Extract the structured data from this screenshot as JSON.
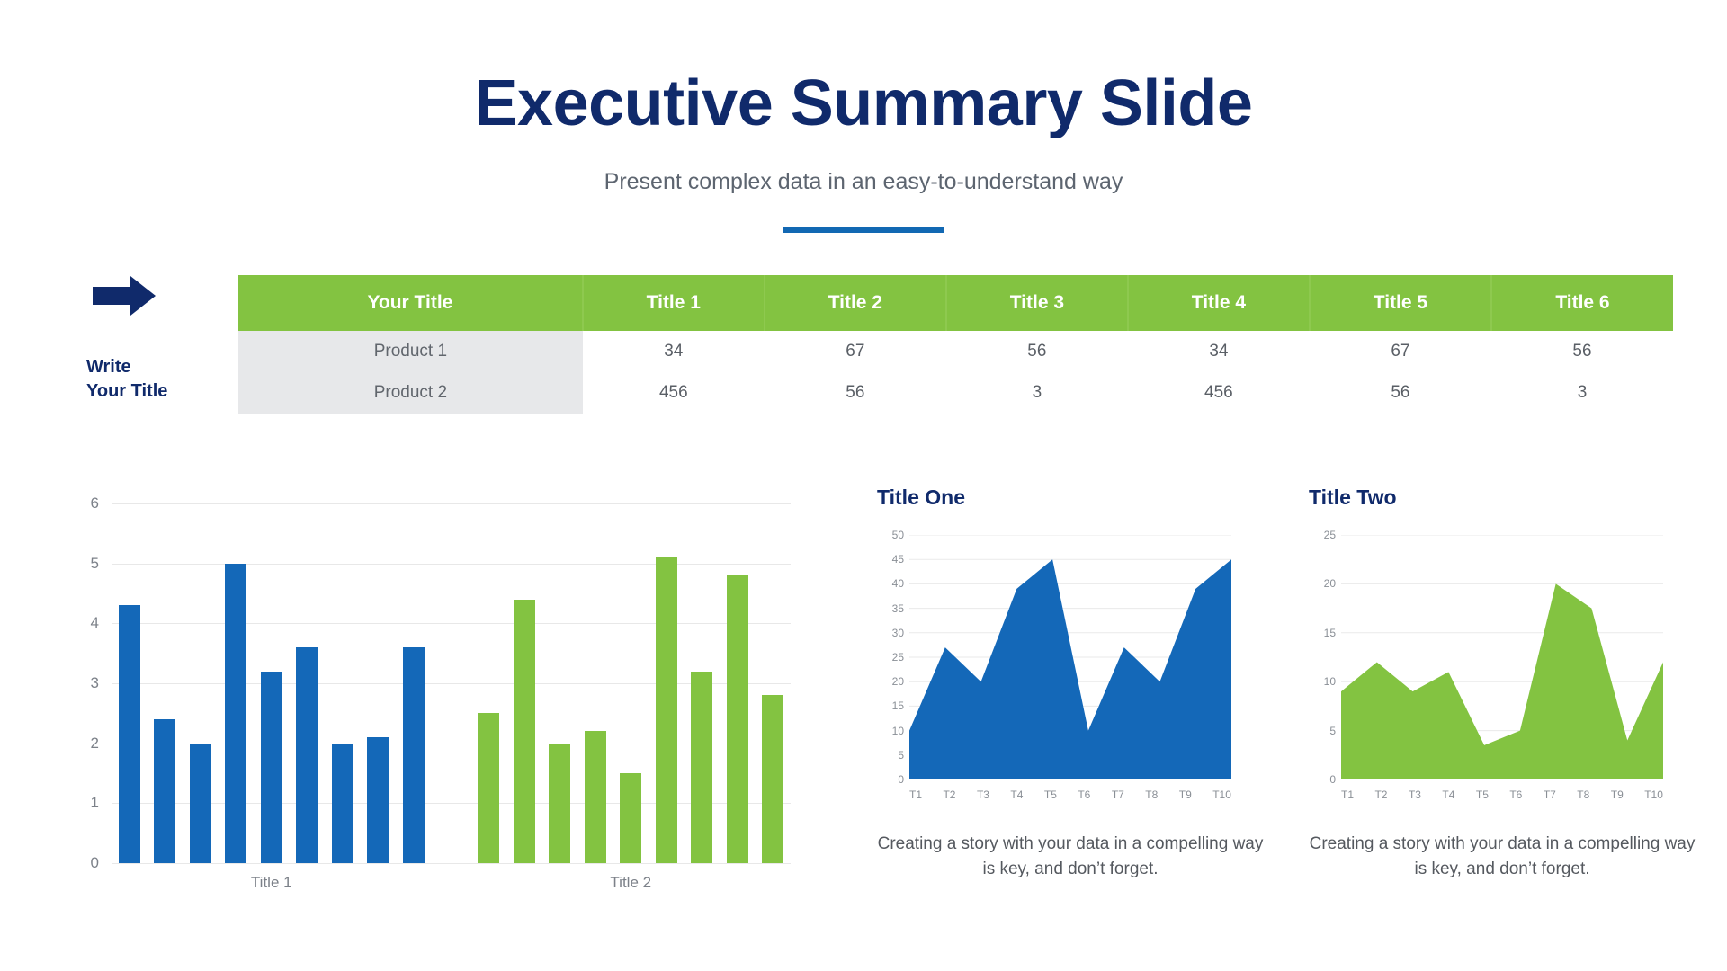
{
  "header": {
    "title": "Executive Summary Slide",
    "subtitle": "Present complex data in an easy-to-understand way",
    "accent_color": "#1268B3"
  },
  "left_panel": {
    "arrow_icon": "right-arrow-icon",
    "label_line1": "Write",
    "label_line2": "Your Title",
    "label_color": "#102A6B"
  },
  "table": {
    "header_color": "#83C341",
    "columns": [
      "Your Title",
      "Title 1",
      "Title 2",
      "Title 3",
      "Title 4",
      "Title 5",
      "Title 6"
    ],
    "rows": [
      {
        "name": "Product 1",
        "values": [
          "34",
          "67",
          "56",
          "34",
          "67",
          "56"
        ]
      },
      {
        "name": "Product 2",
        "values": [
          "456",
          "56",
          "3",
          "456",
          "56",
          "3"
        ]
      }
    ]
  },
  "area_one": {
    "title": "Title One",
    "caption": "Creating a story with your data in a compelling way is key, and don’t forget."
  },
  "area_two": {
    "title": "Title Two",
    "caption": "Creating a story with your data in a compelling way is key, and don’t forget."
  },
  "chart_data": [
    {
      "type": "bar",
      "title": "",
      "xlabel": "",
      "ylabel": "",
      "ylim": [
        0,
        6
      ],
      "yticks": [
        0,
        1,
        2,
        3,
        4,
        5,
        6
      ],
      "grid": true,
      "legend": "none",
      "categories": [
        "Title 1",
        "Title 2"
      ],
      "groups": [
        {
          "name": "Title 1",
          "color": "#1468B8",
          "values": [
            4.3,
            2.4,
            2.0,
            5.0,
            3.2,
            3.6,
            2.0,
            2.1,
            3.6
          ]
        },
        {
          "name": "Title 2",
          "color": "#83C341",
          "values": [
            2.5,
            4.4,
            2.0,
            2.2,
            1.5,
            5.1,
            3.2,
            4.8,
            2.8
          ]
        }
      ]
    },
    {
      "type": "area",
      "title": "Title One",
      "color": "#1468B8",
      "xlabel": "",
      "ylabel": "",
      "ylim": [
        0,
        50
      ],
      "yticks": [
        0,
        5,
        10,
        15,
        20,
        25,
        30,
        35,
        40,
        45,
        50
      ],
      "grid": true,
      "x": [
        "T1",
        "T2",
        "T3",
        "T4",
        "T5",
        "T6",
        "T7",
        "T8",
        "T9",
        "T10"
      ],
      "values": [
        10,
        27,
        20,
        39,
        45,
        10,
        27,
        20,
        39,
        45
      ]
    },
    {
      "type": "area",
      "title": "Title Two",
      "color": "#83C341",
      "xlabel": "",
      "ylabel": "",
      "ylim": [
        0,
        25
      ],
      "yticks": [
        0,
        5,
        10,
        15,
        20,
        25
      ],
      "grid": true,
      "x": [
        "T1",
        "T2",
        "T3",
        "T4",
        "T5",
        "T6",
        "T7",
        "T8",
        "T9",
        "T10"
      ],
      "values": [
        9,
        12,
        9,
        11,
        3.5,
        5,
        20,
        17.5,
        4,
        12
      ]
    }
  ]
}
